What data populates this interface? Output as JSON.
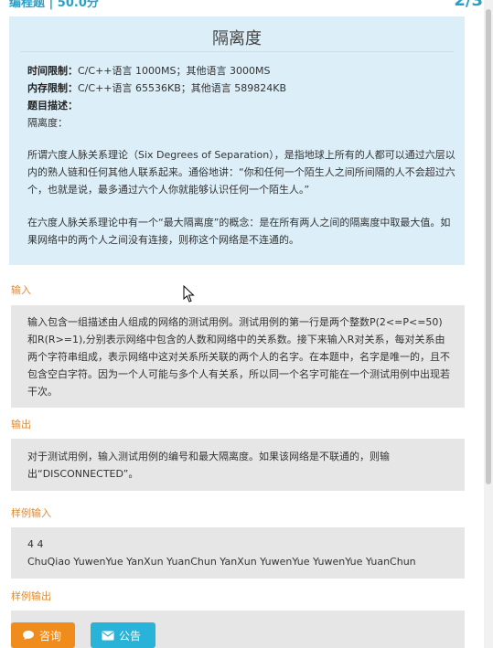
{
  "topbar": {
    "left": "编程题 | 50.0分",
    "right": "2/3"
  },
  "problem": {
    "title": "隔离度",
    "time_label": "时间限制：",
    "time_value": "C/C++语言 1000MS；其他语言 3000MS",
    "mem_label": "内存限制：",
    "mem_value": "C/C++语言 65536KB；其他语言 589824KB",
    "desc_label": "题目描述：",
    "desc_sub": "隔离度：",
    "para1": "所谓六度人脉关系理论（Six Degrees of Separation），是指地球上所有的人都可以通过六层以内的熟人链和任何其他人联系起来。通俗地讲：“你和任何一个陌生人之间所间隔的人不会超过六个，也就是说，最多通过六个人你就能够认识任何一个陌生人。”",
    "para2": "在六度人脉关系理论中有一个“最大隔离度”的概念：是在所有两人之间的隔离度中取最大值。如果网络中的两个人之间没有连接，则称这个网络是不连通的。"
  },
  "input": {
    "label": "输入",
    "text": "输入包含一组描述由人组成的网络的测试用例。测试用例的第一行是两个整数P(2<=P<=50)和R(R>=1),分别表示网络中包含的人数和网络中的关系数。接下来输入R对关系，每对关系由两个字符串组成，表示网络中这对关系所关联的两个人的名字。在本题中，名字是唯一的，且不包含空白字符。因为一个人可能与多个人有关系，所以同一个名字可能在一个测试用例中出现若干次。"
  },
  "output": {
    "label": "输出",
    "text": "对于测试用例，输入测试用例的编号和最大隔离度。如果该网络是不联通的，则输出“DISCONNECTED”。"
  },
  "sample_input": {
    "label": "样例输入",
    "line1": "4 4",
    "line2": "ChuQiao YuwenYue YanXun YuanChun YanXun YuwenYue YuwenYue YuanChun"
  },
  "sample_output": {
    "label": "样例输出"
  },
  "buttons": {
    "consult": "咨询",
    "notice": "公告"
  },
  "colors": {
    "orange": "#f08c1c",
    "cyan": "#2ab3d8",
    "section": "#e08a2e"
  }
}
